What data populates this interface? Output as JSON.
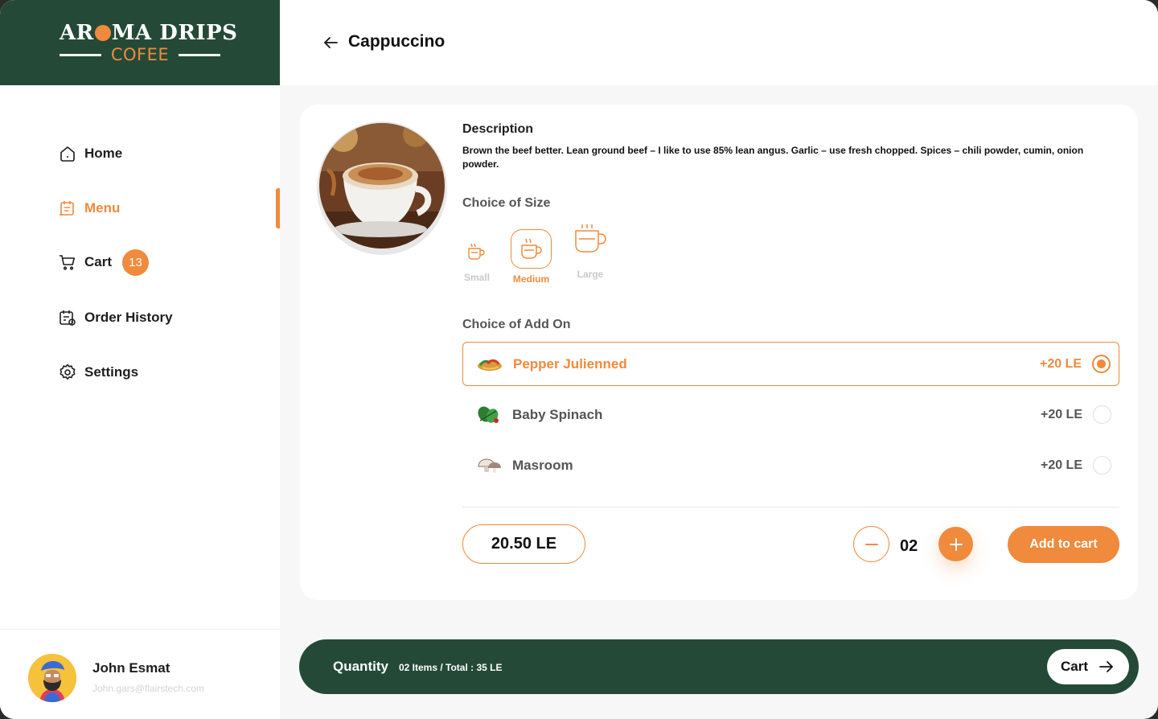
{
  "brand": {
    "name": "AROMA DRIPS",
    "name_left": "AR",
    "name_right": "MA DRIPS",
    "sub": "COFEE",
    "colors": {
      "primary": "#244a37",
      "accent": "#f08a3c"
    }
  },
  "sidebar": {
    "items": [
      {
        "label": "Home",
        "icon": "home-icon",
        "active": false
      },
      {
        "label": "Menu",
        "icon": "menu-icon",
        "active": true
      },
      {
        "label": "Cart",
        "icon": "cart-icon",
        "active": false,
        "badge": "13"
      },
      {
        "label": "Order History",
        "icon": "order-history-icon",
        "active": false
      },
      {
        "label": "Settings",
        "icon": "settings-icon",
        "active": false
      }
    ],
    "user": {
      "name": "John Esmat",
      "email": "John.gars@flairstech.com"
    }
  },
  "header": {
    "title": "Cappuccino"
  },
  "product": {
    "description_title": "Description",
    "description": "Brown the beef better. Lean ground beef – I like to use 85% lean angus. Garlic – use fresh  chopped. Spices – chili powder, cumin, onion powder.",
    "size_title": "Choice of Size",
    "sizes": [
      {
        "label": "Small",
        "selected": false
      },
      {
        "label": "Medium",
        "selected": true
      },
      {
        "label": "Large",
        "selected": false
      }
    ],
    "addon_title": "Choice of Add On",
    "addons": [
      {
        "name": "Pepper Julienned",
        "price": "+20 LE",
        "selected": true
      },
      {
        "name": "Baby Spinach",
        "price": "+20 LE",
        "selected": false
      },
      {
        "name": "Masroom",
        "price": "+20 LE",
        "selected": false
      }
    ],
    "price": "20.50 LE",
    "quantity": "02",
    "add_to_cart_label": "Add to cart"
  },
  "bottom_bar": {
    "label": "Quantity",
    "summary": "02 Items / Total : 35 LE",
    "cart_label": "Cart"
  }
}
